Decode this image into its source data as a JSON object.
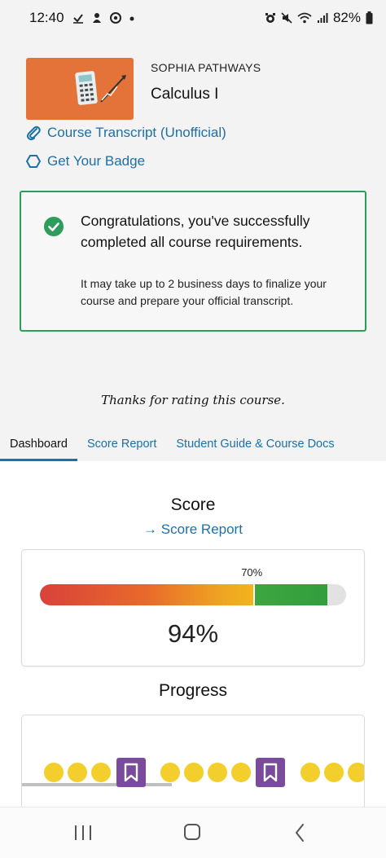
{
  "status_bar": {
    "time": "12:40",
    "left_icons": [
      "check-download-icon",
      "notification-icon",
      "chrome-icon",
      "dot-icon"
    ],
    "right_icons": [
      "alarm-icon",
      "mute-icon",
      "wifi-icon",
      "signal-icon"
    ],
    "battery": "82%"
  },
  "course": {
    "provider": "SOPHIA PATHWAYS",
    "title": "Calculus I",
    "thumbnail_color": "#e4733a"
  },
  "links": {
    "transcript": "Course Transcript (Unofficial)",
    "badge": "Get Your Badge"
  },
  "congrats": {
    "title": "Congratulations, you've successfully completed all course requirements.",
    "subtitle": "It may take up to 2 business days to finalize your course and prepare your official transcript."
  },
  "rating_message": "Thanks for rating this course.",
  "tabs": [
    {
      "label": "Dashboard",
      "active": true
    },
    {
      "label": "Score Report",
      "active": false
    },
    {
      "label": "Student Guide & Course Docs",
      "active": false
    }
  ],
  "score": {
    "heading": "Score",
    "link_arrow": "→",
    "link_label": "Score Report",
    "value_text": "94%",
    "value": 0.94,
    "threshold_label": "70%",
    "threshold": 0.7
  },
  "progress": {
    "heading": "Progress"
  },
  "colors": {
    "accent": "#1d6fa8",
    "success": "#2e9c5a",
    "milestone_dot": "#f2cf2c",
    "bookmark": "#7a4b9c"
  }
}
